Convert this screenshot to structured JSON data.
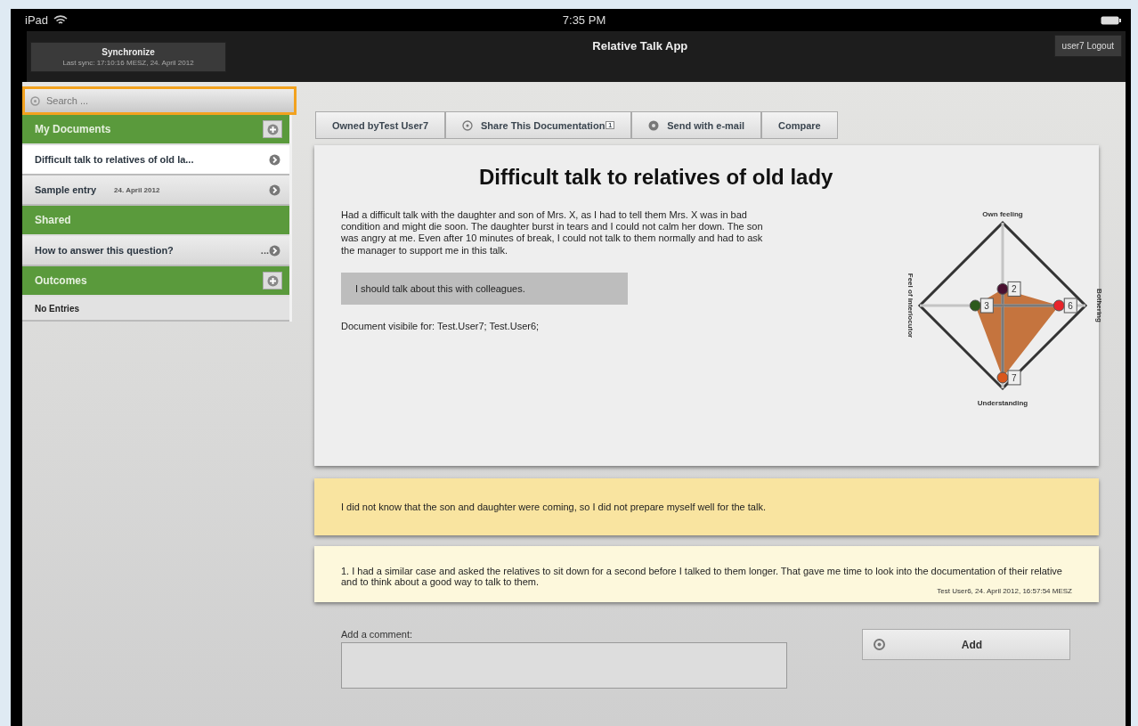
{
  "status_bar": {
    "device": "iPad",
    "time": "7:35 PM"
  },
  "nav_bar": {
    "sync_button": {
      "label": "Synchronize",
      "last_sync": "Last sync: 17:10:16 MESZ, 24. April 2012"
    },
    "title": "Relative Talk App",
    "logout_button": "user7 Logout"
  },
  "sidebar": {
    "search": {
      "placeholder": "Search ..."
    },
    "sections": [
      {
        "title": "My Documents",
        "has_add": true,
        "items": [
          {
            "kind": "entry",
            "label": "Difficult talk to relatives of old la...",
            "selected": true
          },
          {
            "kind": "entry",
            "label": "Sample entry",
            "date": "24. April 2012",
            "selected": false
          }
        ]
      },
      {
        "title": "Shared",
        "has_add": false,
        "items": [
          {
            "kind": "entry",
            "label": "How to answer this question?",
            "suffix": "...",
            "selected": false
          }
        ]
      },
      {
        "title": "Outcomes",
        "has_add": true,
        "items": [
          {
            "kind": "empty",
            "label": "No Entries"
          }
        ]
      }
    ]
  },
  "toolbar": [
    {
      "kind": "text",
      "label": "Owned byTest User7"
    },
    {
      "kind": "share",
      "label": "Share This Documentation",
      "badge": "1"
    },
    {
      "kind": "mail",
      "label": "Send with e-mail"
    },
    {
      "kind": "text",
      "label": "Compare"
    }
  ],
  "document": {
    "title": "Difficult talk to relatives of old lady",
    "body": "Had a difficult talk with the daughter and son of Mrs. X, as I had to tell them Mrs. X was in bad condition and might die soon. The daughter burst in tears and I could not calm her down. The son was angry at me. Even after 10 minutes of break, I could not talk to them normally and had to ask the manager to support me in this talk.",
    "note": "I should talk about this with colleagues.",
    "visibility": "Document visibile for: Test.User7; Test.User6;",
    "radar_axes": [
      "Own feeling",
      "Bothering",
      "Understanding",
      "Feel of interlocutor"
    ],
    "radar": [
      {
        "value": "2",
        "level": 0.2,
        "color": "#4a1030"
      },
      {
        "value": "6",
        "level": 0.68,
        "color": "#e8242a"
      },
      {
        "value": "7",
        "level": 0.87,
        "color": "#d8561c"
      },
      {
        "value": "3",
        "level": 0.33,
        "color": "#2d5a1c"
      }
    ]
  },
  "outcome": "I did not know that the son and daughter were coming, so I did not prepare myself well for the talk.",
  "comments": [
    {
      "text": "1. I had a similar case and asked the relatives to sit down for a second before I talked to them longer. That gave me time to look into the documentation of their relative and to think about a good way to talk to them.",
      "meta": "Test User6, 24. April 2012, 16:57:54 MESZ"
    }
  ],
  "add_comment": {
    "label": "Add a comment:",
    "button": "Add"
  }
}
